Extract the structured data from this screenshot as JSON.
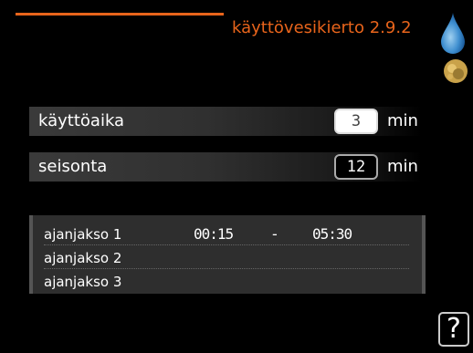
{
  "header": {
    "title": "käyttövesikierto 2.9.2",
    "accent_color": "#e8641b",
    "icons": [
      "water-drop-icon",
      "heating-icon"
    ]
  },
  "settings": [
    {
      "label": "käyttöaika",
      "value": "3",
      "unit": "min",
      "selected": true
    },
    {
      "label": "seisonta",
      "value": "12",
      "unit": "min",
      "selected": false
    }
  ],
  "periods": [
    {
      "label": "ajanjakso 1",
      "start": "00:15",
      "separator": "-",
      "end": "05:30"
    },
    {
      "label": "ajanjakso 2",
      "start": "",
      "separator": "",
      "end": ""
    },
    {
      "label": "ajanjakso 3",
      "start": "",
      "separator": "",
      "end": ""
    }
  ],
  "help": {
    "label": "?"
  }
}
